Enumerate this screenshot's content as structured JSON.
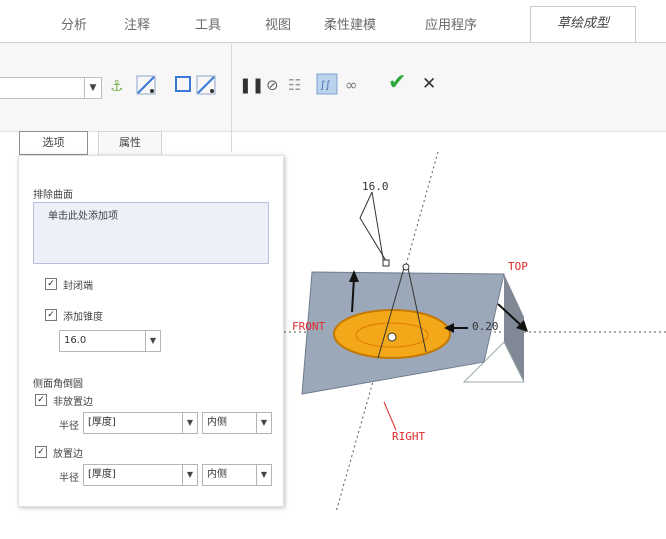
{
  "menu_tabs": [
    {
      "label": "分析"
    },
    {
      "label": "注释"
    },
    {
      "label": "工具"
    },
    {
      "label": "视图"
    },
    {
      "label": "柔性建模"
    },
    {
      "label": "应用程序"
    },
    {
      "label": "草绘成型"
    }
  ],
  "ribbon": {
    "combo_value": "",
    "icons": [
      "anchor-icon",
      "axis-toggle-icon",
      "frame-icon",
      "axis-toggle-icon",
      "pause-icon",
      "stop-icon",
      "preview-glasses-icon",
      "verify-preview-icon",
      "glasses-icon",
      "confirm-icon",
      "cancel-icon"
    ]
  },
  "option_tabs": {
    "options": "选项",
    "properties": "属性"
  },
  "options_panel": {
    "exclude_surfaces_label": "排除曲面",
    "exclude_surfaces_placeholder": "单击此处添加项",
    "checkbox_seal_label": "封闭端",
    "checkbox_seal_checked": true,
    "checkbox_draft_label": "添加锥度",
    "checkbox_draft_checked": true,
    "draft_value": "16.0",
    "round_edges_label": "侧面角倒圆",
    "non_placement_edge_label": "非放置边",
    "non_placement_edge_checked": true,
    "radius_label_1": "半径",
    "radius_value_1": "[厚度]",
    "side_value_1": "内侧",
    "placement_edge_label": "放置边",
    "placement_edge_checked": true,
    "radius_label_2": "半径",
    "radius_value_2": "[厚度]",
    "side_value_2": "内侧"
  },
  "viewport": {
    "dim_angle": "16.0",
    "dim_depth": "0.20",
    "plane_top": "TOP",
    "plane_front": "FRONT",
    "plane_right": "RIGHT",
    "colors": {
      "plane_fill": "#9aa8b9",
      "sketch_fill": "#f2a818",
      "datum_red": "#e02a2a",
      "accent_green": "#3aa33a"
    }
  }
}
